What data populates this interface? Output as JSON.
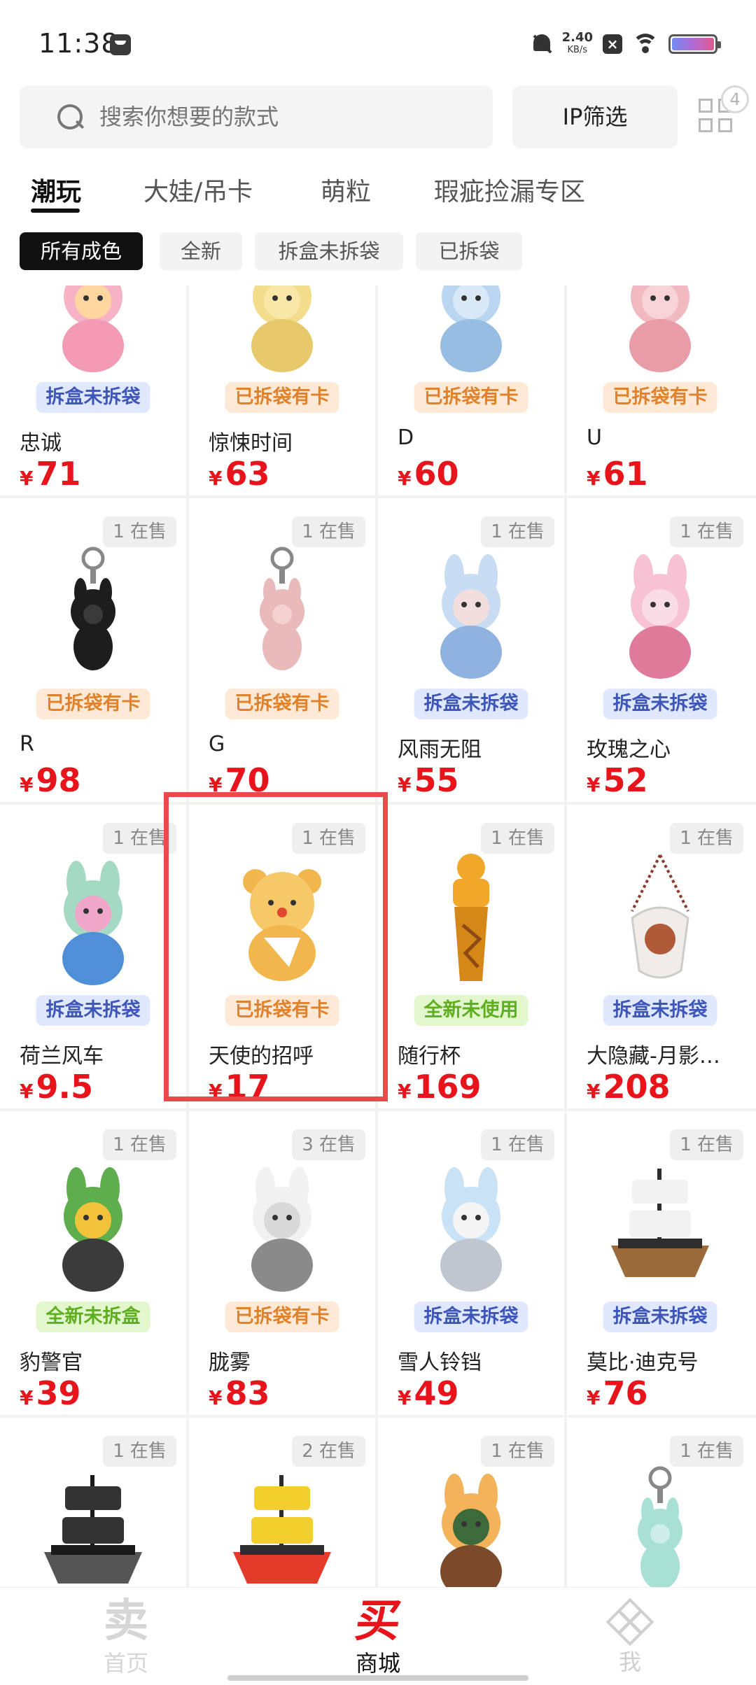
{
  "status_bar": {
    "time": "11:38",
    "net_speed": "2.40",
    "net_unit": "KB/s",
    "battery_colors": [
      "#6f8cf2",
      "#b36ad6",
      "#e05a8f"
    ]
  },
  "search": {
    "placeholder": "搜索你想要的款式",
    "ip_filter_label": "IP筛选",
    "grid_badge": "4"
  },
  "tabs": [
    {
      "label": "潮玩",
      "active": true
    },
    {
      "label": "大娃/吊卡",
      "active": false
    },
    {
      "label": "萌粒",
      "active": false
    },
    {
      "label": "瑕疵捡漏专区",
      "active": false
    }
  ],
  "chips": [
    {
      "label": "所有成色",
      "active": true
    },
    {
      "label": "全新",
      "active": false
    },
    {
      "label": "拆盒未拆袋",
      "active": false
    },
    {
      "label": "已拆袋",
      "active": false
    }
  ],
  "currency": "¥",
  "products": [
    {
      "name": "忠诚",
      "price": "71",
      "tag": "拆盒未拆袋",
      "tag_color": "blue",
      "stock": "",
      "icon": "pink-labubu-figure-icon"
    },
    {
      "name": "惊悚时间",
      "price": "63",
      "tag": "已拆袋有卡",
      "tag_color": "orange",
      "stock": "",
      "icon": "yellow-plush-figure-icon"
    },
    {
      "name": "D",
      "price": "60",
      "tag": "已拆袋有卡",
      "tag_color": "orange",
      "stock": "",
      "icon": "blue-bunny-figure-icon"
    },
    {
      "name": "U",
      "price": "61",
      "tag": "已拆袋有卡",
      "tag_color": "orange",
      "stock": "",
      "icon": "pink-bunny-figure-icon"
    },
    {
      "name": "R",
      "price": "98",
      "tag": "已拆袋有卡",
      "tag_color": "orange",
      "stock": "1 在售",
      "icon": "black-labubu-keychain-icon"
    },
    {
      "name": "G",
      "price": "70",
      "tag": "已拆袋有卡",
      "tag_color": "orange",
      "stock": "1 在售",
      "icon": "pink-labubu-keychain-icon"
    },
    {
      "name": "风雨无阻",
      "price": "55",
      "tag": "拆盒未拆袋",
      "tag_color": "blue",
      "stock": "1 在售",
      "icon": "blue-girl-figure-icon"
    },
    {
      "name": "玫瑰之心",
      "price": "52",
      "tag": "拆盒未拆袋",
      "tag_color": "blue",
      "stock": "1 在售",
      "icon": "pink-rose-plush-icon"
    },
    {
      "name": "荷兰风车",
      "price": "9.5",
      "tag": "拆盒未拆袋",
      "tag_color": "blue",
      "stock": "1 在售",
      "icon": "windmill-figure-icon"
    },
    {
      "name": "天使的招呼",
      "price": "17",
      "tag": "已拆袋有卡",
      "tag_color": "orange",
      "stock": "1 在售",
      "icon": "teddy-bear-figure-icon"
    },
    {
      "name": "随行杯",
      "price": "169",
      "tag": "全新未使用",
      "tag_color": "green",
      "stock": "1 在售",
      "icon": "tumbler-cup-icon"
    },
    {
      "name": "大隐藏-月影…",
      "price": "208",
      "tag": "拆盒未拆袋",
      "tag_color": "blue",
      "stock": "1 在售",
      "icon": "acrylic-charm-icon"
    },
    {
      "name": "豹警官",
      "price": "39",
      "tag": "全新未拆盒",
      "tag_color": "green",
      "stock": "1 在售",
      "icon": "leopard-officer-figure-icon"
    },
    {
      "name": "胧雾",
      "price": "83",
      "tag": "已拆袋有卡",
      "tag_color": "orange",
      "stock": "3 在售",
      "icon": "white-fluffy-figure-icon"
    },
    {
      "name": "雪人铃铛",
      "price": "49",
      "tag": "拆盒未拆袋",
      "tag_color": "blue",
      "stock": "1 在售",
      "icon": "snowman-bell-figure-icon"
    },
    {
      "name": "莫比·迪克号",
      "price": "76",
      "tag": "拆盒未拆袋",
      "tag_color": "blue",
      "stock": "1 在售",
      "icon": "white-ship-figure-icon"
    },
    {
      "name": "",
      "price": "",
      "tag": "",
      "tag_color": "",
      "stock": "1 在售",
      "icon": "black-pirate-ship-icon"
    },
    {
      "name": "",
      "price": "",
      "tag": "",
      "tag_color": "",
      "stock": "2 在售",
      "icon": "yellow-submarine-ship-icon"
    },
    {
      "name": "",
      "price": "",
      "tag": "",
      "tag_color": "",
      "stock": "1 在售",
      "icon": "aviator-chest-figure-icon"
    },
    {
      "name": "",
      "price": "",
      "tag": "",
      "tag_color": "",
      "stock": "1 在售",
      "icon": "mint-bunny-keychain-icon"
    }
  ],
  "highlighted_product": "天使的招呼",
  "bottom_nav": [
    {
      "glyph": "卖",
      "label": "首页",
      "active": false
    },
    {
      "glyph": "买",
      "label": "商城",
      "active": true
    },
    {
      "glyph": "",
      "label": "我",
      "active": false
    }
  ],
  "colors": {
    "price": "#e8141b",
    "highlight_border": "#ea4a4c",
    "tag_blue_bg": "#e0e8ff",
    "tag_orange_bg": "#fde9d6",
    "tag_green_bg": "#e3f7cc"
  }
}
